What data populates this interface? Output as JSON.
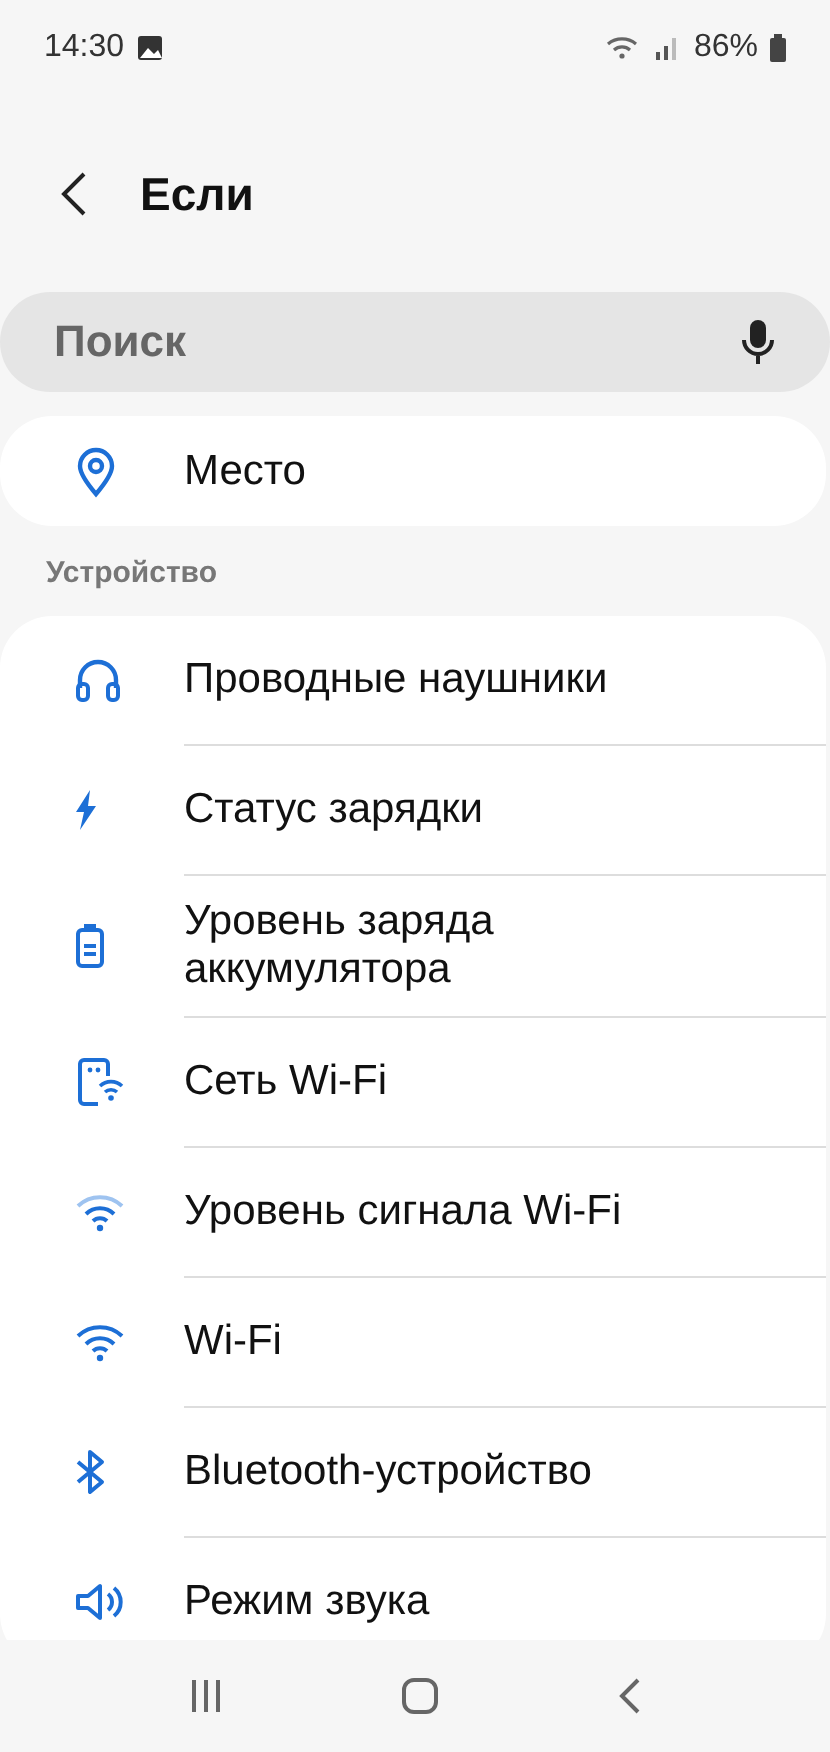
{
  "status_bar": {
    "time": "14:30",
    "battery": "86%"
  },
  "header": {
    "title": "Если"
  },
  "search": {
    "placeholder": "Поиск"
  },
  "top_items": [
    {
      "label": "Место"
    }
  ],
  "sections": [
    {
      "title": "Устройство",
      "items": [
        {
          "label": "Проводные наушники"
        },
        {
          "label": "Статус зарядки"
        },
        {
          "label": "Уровень заряда аккумулятора"
        },
        {
          "label": "Сеть Wi-Fi"
        },
        {
          "label": "Уровень сигнала Wi-Fi"
        },
        {
          "label": "Wi-Fi"
        },
        {
          "label": "Bluetooth-устройство"
        },
        {
          "label": "Режим звука"
        }
      ]
    }
  ]
}
